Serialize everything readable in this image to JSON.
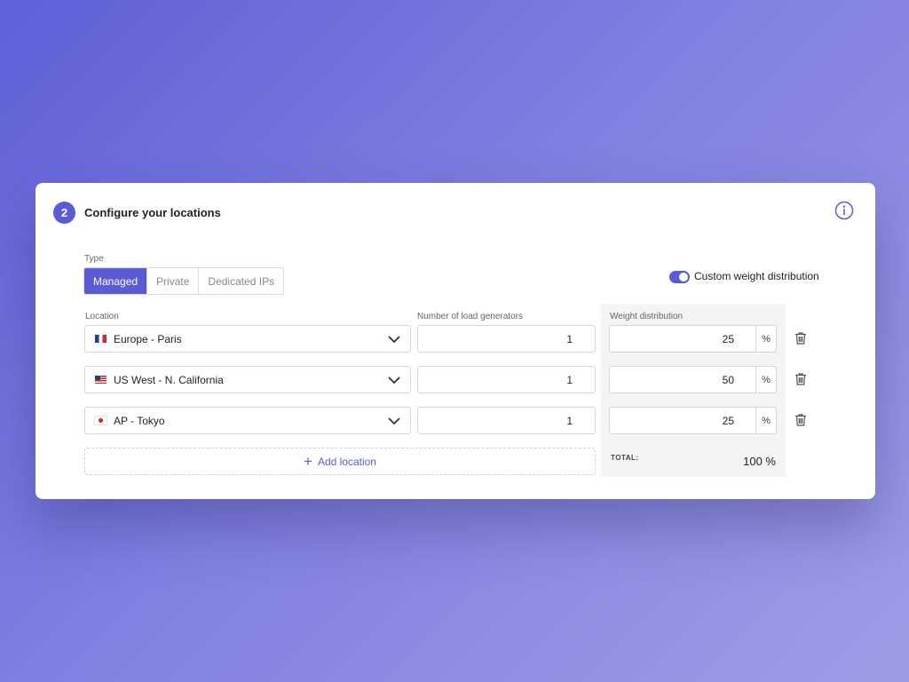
{
  "step": {
    "number": "2",
    "title": "Configure your locations"
  },
  "type": {
    "label": "Type",
    "options": [
      "Managed",
      "Private",
      "Dedicated IPs"
    ],
    "selected": "Managed"
  },
  "custom_weight": {
    "label": "Custom weight distribution",
    "enabled": true
  },
  "columns": {
    "location": "Location",
    "load_generators": "Number of load generators",
    "weight": "Weight distribution"
  },
  "rows": [
    {
      "location": "Europe - Paris",
      "flag": "france-flag-icon",
      "generators": "1",
      "weight": "25",
      "unit": "%"
    },
    {
      "location": "US West - N. California",
      "flag": "usa-flag-icon",
      "generators": "1",
      "weight": "50",
      "unit": "%"
    },
    {
      "location": "AP - Tokyo",
      "flag": "japan-flag-icon",
      "generators": "1",
      "weight": "25",
      "unit": "%"
    }
  ],
  "add_location": "Add location",
  "total": {
    "label": "TOTAL:",
    "value": "100 %"
  },
  "colors": {
    "accent": "#5b5bd6",
    "background_start": "#5f5fd8",
    "background_end": "#9d9de6"
  }
}
